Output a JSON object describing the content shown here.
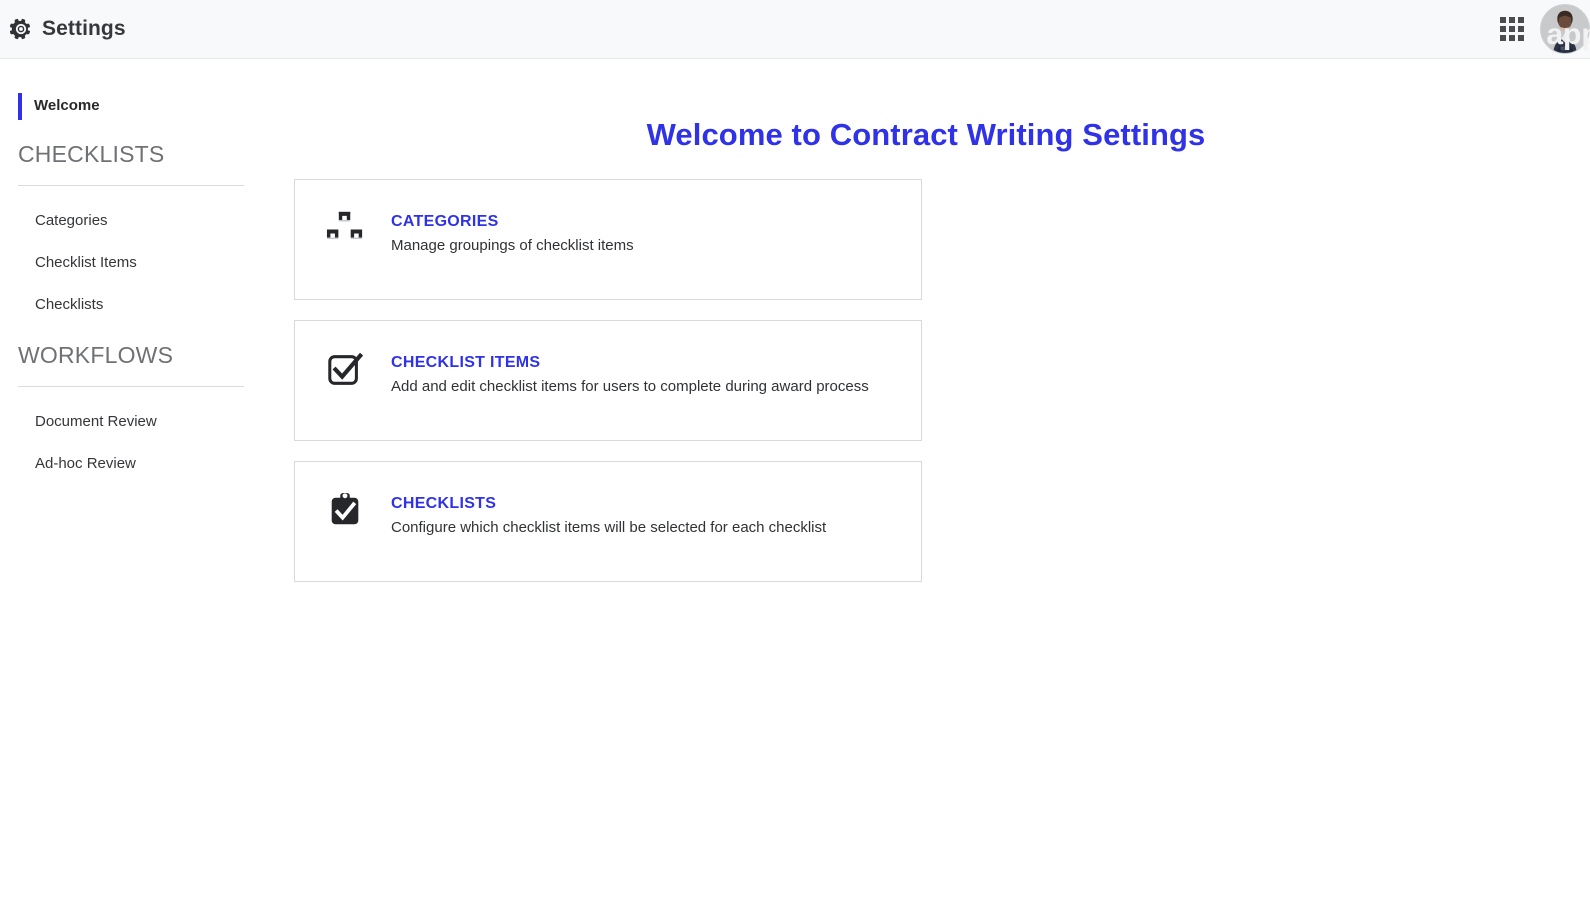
{
  "header": {
    "gear_icon": "gear-icon",
    "title": "Settings",
    "apps_icon": "apps-grid-icon",
    "avatar_icon": "user-avatar",
    "watermark": "appi"
  },
  "sidebar": {
    "active_item": {
      "label": "Welcome"
    },
    "sections": [
      {
        "title": "CHECKLISTS",
        "items": [
          {
            "label": "Categories"
          },
          {
            "label": "Checklist Items"
          },
          {
            "label": "Checklists"
          }
        ]
      },
      {
        "title": "WORKFLOWS",
        "items": [
          {
            "label": "Document Review"
          },
          {
            "label": "Ad-hoc Review"
          }
        ]
      }
    ]
  },
  "main": {
    "page_title": "Welcome to Contract Writing Settings",
    "cards": [
      {
        "icon": "boxes-icon",
        "title": "CATEGORIES",
        "description": "Manage groupings of checklist items"
      },
      {
        "icon": "check-square-icon",
        "title": "CHECKLIST ITEMS",
        "description": "Add and edit checklist items for users to complete during award process"
      },
      {
        "icon": "clipboard-check-icon",
        "title": "CHECKLISTS",
        "description": "Configure which checklist items will be selected for each checklist"
      }
    ]
  },
  "colors": {
    "accent_blue": "#2f32e6",
    "header_bg": "#f8f9fb",
    "card_border": "#d7d9dc",
    "text_dark": "#303236",
    "section_gray": "#6f7175"
  }
}
